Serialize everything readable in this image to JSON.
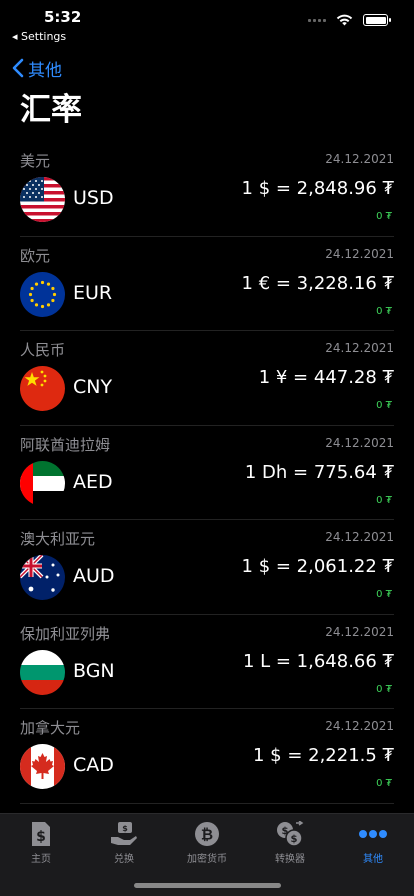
{
  "status": {
    "time": "5:32",
    "back_app": "◂ Settings"
  },
  "nav": {
    "back_label": "其他"
  },
  "title": "汇率",
  "currencies": [
    {
      "name": "美元",
      "code": "USD",
      "date": "24.12.2021",
      "rate": "1 $ = 2,848.96 ₮",
      "change": "0 ₮",
      "flag": "usd-flag-icon"
    },
    {
      "name": "欧元",
      "code": "EUR",
      "date": "24.12.2021",
      "rate": "1 € = 3,228.16 ₮",
      "change": "0 ₮",
      "flag": "eur-flag-icon"
    },
    {
      "name": "人民币",
      "code": "CNY",
      "date": "24.12.2021",
      "rate": "1 ¥ = 447.28 ₮",
      "change": "0 ₮",
      "flag": "cny-flag-icon"
    },
    {
      "name": "阿联酋迪拉姆",
      "code": "AED",
      "date": "24.12.2021",
      "rate": "1 Dh = 775.64 ₮",
      "change": "0 ₮",
      "flag": "aed-flag-icon"
    },
    {
      "name": "澳大利亚元",
      "code": "AUD",
      "date": "24.12.2021",
      "rate": "1 $ = 2,061.22 ₮",
      "change": "0 ₮",
      "flag": "aud-flag-icon"
    },
    {
      "name": "保加利亚列弗",
      "code": "BGN",
      "date": "24.12.2021",
      "rate": "1 L = 1,648.66 ₮",
      "change": "0 ₮",
      "flag": "bgn-flag-icon"
    },
    {
      "name": "加拿大元",
      "code": "CAD",
      "date": "24.12.2021",
      "rate": "1 $ = 2,221.5 ₮",
      "change": "0 ₮",
      "flag": "cad-flag-icon"
    }
  ],
  "tabs": [
    {
      "label": "主页",
      "icon": "dollar-doc-icon"
    },
    {
      "label": "兑换",
      "icon": "exchange-hand-icon"
    },
    {
      "label": "加密货币",
      "icon": "bitcoin-icon"
    },
    {
      "label": "转换器",
      "icon": "converter-icon"
    },
    {
      "label": "其他",
      "icon": "more-dots-icon",
      "active": true
    }
  ],
  "colors": {
    "accent": "#2f8cff",
    "positive": "#3ed35a",
    "secondary_text": "#8e8e93"
  }
}
